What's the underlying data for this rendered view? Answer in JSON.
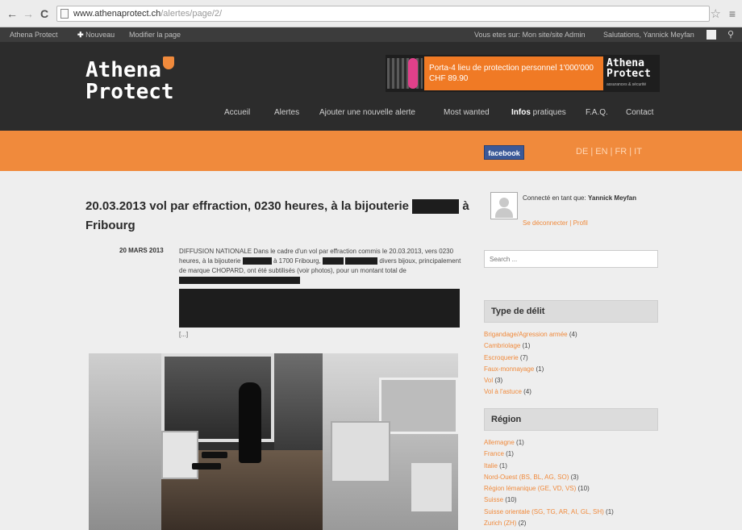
{
  "browser": {
    "url_main": "www.athenaprotect.ch",
    "url_path": "/alertes/page/2/"
  },
  "adminbar": {
    "site_name": "Athena Protect",
    "new_label": "Nouveau",
    "edit_label": "Modifier la page",
    "hello_label": "Vous etes sur: Mon site/site Admin",
    "user_label": "Salutations, Yannick Meyfan"
  },
  "header": {
    "logo_line1": "Athena",
    "logo_line2": "Protect",
    "banner_text": "Porta-4 lieu de protection personnel 1'000'000 CHF 89.90",
    "banner_logo_line1": "Athena",
    "banner_logo_line2": "Protect",
    "banner_tagline": "assurances & sécurité",
    "nav": [
      {
        "label": "Accueil"
      },
      {
        "label": "Alertes"
      },
      {
        "label": "Ajouter une nouvelle alerte"
      },
      {
        "label": "Most wanted"
      },
      {
        "label_bold": "Infos",
        "label_rest": "pratiques"
      },
      {
        "label": "F.A.Q."
      },
      {
        "label": "Contact"
      }
    ]
  },
  "orangebar": {
    "facebook_label": "facebook",
    "languages": "DE | EN | FR | IT"
  },
  "post": {
    "title_before": "20.03.2013 vol par effraction, 0230 heures, à la bijouterie",
    "title_after": "à Fribourg",
    "date": "20 MARS 2013",
    "text_1": "DIFFUSION NATIONALE Dans le cadre d'un vol par effraction commis le 20.03.2013, vers 0230 heures, à la bijouterie",
    "text_2": "à 1700 Fribourg,",
    "text_3": "divers bijoux, principalement de marque CHOPARD, ont été subtilisés (voir photos), pour un montant total de",
    "more_label": "[...]"
  },
  "sidebar": {
    "login_prefix": "Connecté en tant que:",
    "login_user": "Yannick Meyfan",
    "logout_label": "Se déconnecter",
    "profile_label": "Profil",
    "search_placeholder": "Search ...",
    "types_title": "Type de délit",
    "types": [
      {
        "name": "Brigandage/Agression armée",
        "count": "(4)"
      },
      {
        "name": "Cambriolage",
        "count": "(1)"
      },
      {
        "name": "Escroquerie",
        "count": "(7)"
      },
      {
        "name": "Faux-monnayage",
        "count": "(1)"
      },
      {
        "name": "Vol",
        "count": "(3)"
      },
      {
        "name": "Vol à l'astuce",
        "count": "(4)"
      }
    ],
    "regions_title": "Région",
    "regions": [
      {
        "name": "Allemagne",
        "count": "(1)"
      },
      {
        "name": "France",
        "count": "(1)"
      },
      {
        "name": "Italie",
        "count": "(1)"
      },
      {
        "name": "Nord-Ouest (BS, BL, AG, SO)",
        "count": "(3)"
      },
      {
        "name": "Région lémanique (GE, VD, VS)",
        "count": "(10)"
      },
      {
        "name": "Suisse",
        "count": "(10)"
      },
      {
        "name": "Suisse orientale (SG, TG, AR, AI, GL, SH)",
        "count": "(1)"
      },
      {
        "name": "Zurich (ZH)",
        "count": "(2)"
      }
    ]
  },
  "colors": {
    "accent": "#f08a3c",
    "header_bg": "#2c2c2c",
    "facebook": "#3b5998"
  }
}
